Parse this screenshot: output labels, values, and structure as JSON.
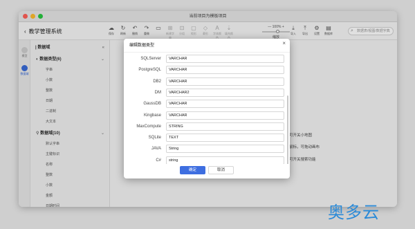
{
  "window": {
    "title": "当前项目为模板项目"
  },
  "app": {
    "back": "‹",
    "title": "教学管理系统"
  },
  "toolbar": {
    "tools": [
      {
        "icon": "☁",
        "label": "保存",
        "name": "save"
      },
      {
        "icon": "↻",
        "label": "刷新",
        "name": "refresh"
      },
      {
        "icon": "↶",
        "label": "撤销",
        "name": "undo"
      },
      {
        "icon": "↷",
        "label": "重做",
        "name": "redo"
      },
      {
        "icon": "▭",
        "label": "",
        "name": "spacer"
      },
      {
        "icon": "⊞",
        "label": "新建字典",
        "name": "new-dict"
      },
      {
        "icon": "⊡",
        "label": "分组",
        "name": "group"
      },
      {
        "icon": "▢",
        "label": "矩形",
        "name": "rect"
      },
      {
        "icon": "◇",
        "label": "菱形",
        "name": "diamond"
      },
      {
        "icon": "A",
        "label": "字体颜色",
        "name": "font-color"
      },
      {
        "icon": "⇣",
        "label": "填充颜色",
        "name": "fill-color"
      }
    ],
    "zoom_label": "— 100% +",
    "zoom_sub": "缩放",
    "right_tools": [
      {
        "icon": "⤓",
        "label": "导入",
        "name": "import"
      },
      {
        "icon": "⤒",
        "label": "导出",
        "name": "export"
      },
      {
        "icon": "⚙",
        "label": "设置",
        "name": "settings"
      },
      {
        "icon": "▤",
        "label": "数据库",
        "name": "database"
      }
    ],
    "search_placeholder": "数据表/视图/数据字典"
  },
  "leftbar": [
    {
      "label": "模型",
      "active": false
    },
    {
      "label": "数据域",
      "active": true
    }
  ],
  "tree": {
    "header": "| 数据域",
    "collapse": "«",
    "groups": [
      {
        "title": "数据类型(6)",
        "items": [
          "字串",
          "小数",
          "整数",
          "日期",
          "二进制",
          "大文本"
        ]
      },
      {
        "title": "数据域(10)",
        "items": [
          "默认字串",
          "主键标识",
          "名称",
          "整数",
          "小数",
          "金额",
          "日期时间"
        ]
      }
    ]
  },
  "hints": [
    "可开关小地图",
    "鼠标，可拖动画布",
    "可开关搜索功能"
  ],
  "dialog": {
    "title": "编辑数据类型",
    "close": "×",
    "rows": [
      {
        "label": "SQLServer",
        "value": "VARCHAR"
      },
      {
        "label": "PostgreSQL",
        "value": "VARCHAR"
      },
      {
        "label": "DB2",
        "value": "VARCHAR"
      },
      {
        "label": "DM",
        "value": "VARCHAR2"
      },
      {
        "label": "GaussDB",
        "value": "VARCHAR"
      },
      {
        "label": "Kingbase",
        "value": "VARCHAR"
      },
      {
        "label": "MaxCompute",
        "value": "STRING"
      },
      {
        "label": "SQLite",
        "value": "TEXT"
      },
      {
        "label": "JAVA",
        "value": "String"
      },
      {
        "label": "C#",
        "value": "string"
      }
    ],
    "ok": "确定",
    "cancel": "取消"
  },
  "watermark": "奥多云"
}
